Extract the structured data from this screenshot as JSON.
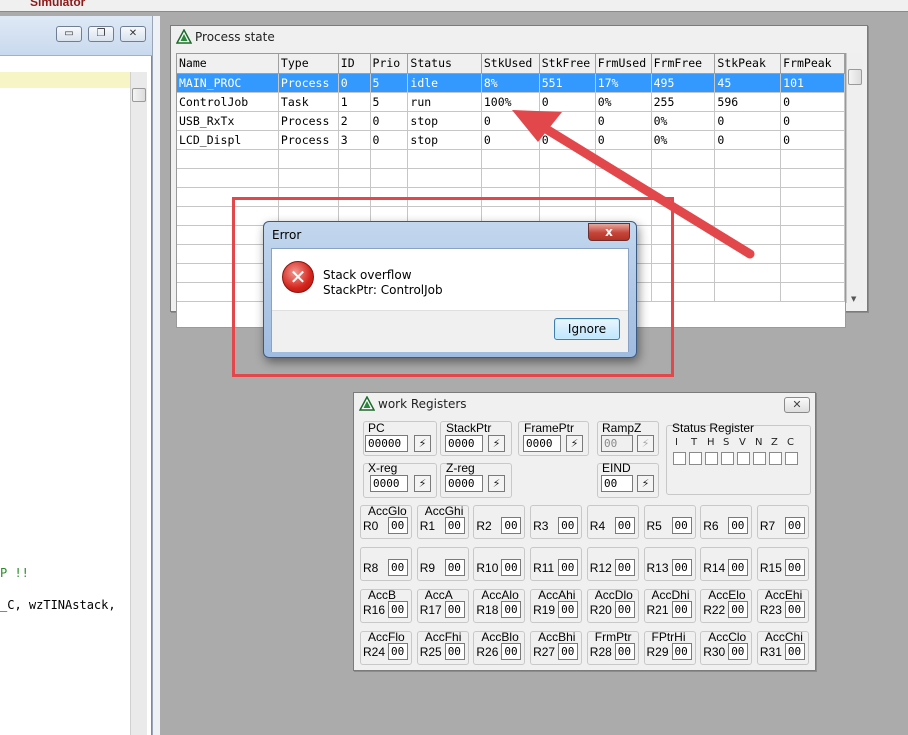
{
  "app": {
    "name": "Simulator"
  },
  "editor": {
    "line_a": "P !!",
    "line_b": "_C, wzTINAstack,"
  },
  "process_window": {
    "title": "Process state",
    "columns": [
      "Name",
      "Type",
      "ID",
      "Prio",
      "Status",
      "StkUsed",
      "StkFree",
      "FrmUsed",
      "FrmFree",
      "StkPeak",
      "FrmPeak"
    ],
    "rows": [
      [
        "MAIN_PROC",
        "Process",
        "0",
        "5",
        "idle",
        "8%",
        "551",
        "17%",
        "495",
        "45",
        "101"
      ],
      [
        "ControlJob",
        "Task",
        "1",
        "5",
        "run",
        "100%",
        "0",
        "0%",
        "255",
        "596",
        "0"
      ],
      [
        "USB_RxTx",
        "Process",
        "2",
        "0",
        "stop",
        "0",
        "0",
        "0",
        "0%",
        "0",
        "0"
      ],
      [
        "LCD_Displ",
        "Process",
        "3",
        "0",
        "stop",
        "0",
        "0",
        "0",
        "0%",
        "0",
        "0"
      ]
    ],
    "selected_row": 0
  },
  "error_dialog": {
    "title": "Error",
    "close_label": "x",
    "message_line1": "Stack overflow",
    "message_line2": "StackPtr: ControlJob",
    "ignore_label": "Ignore"
  },
  "registers_window": {
    "title": "work Registers",
    "pc": {
      "label": "PC",
      "value": "00000"
    },
    "stackptr": {
      "label": "StackPtr",
      "value": "0000"
    },
    "frameptr": {
      "label": "FramePtr",
      "value": "0000"
    },
    "rampz": {
      "label": "RampZ",
      "value": "00"
    },
    "xreg": {
      "label": "X-reg",
      "value": "0000"
    },
    "zreg": {
      "label": "Z-reg",
      "value": "0000"
    },
    "eind": {
      "label": "EIND",
      "value": "00"
    },
    "status_register": {
      "label": "Status Register",
      "flags": [
        "I",
        "T",
        "H",
        "S",
        "V",
        "N",
        "Z",
        "C"
      ]
    },
    "registers": [
      {
        "alias": "AccGlo",
        "name": "R0",
        "value": "00"
      },
      {
        "alias": "AccGhi",
        "name": "R1",
        "value": "00"
      },
      {
        "alias": "",
        "name": "R2",
        "value": "00"
      },
      {
        "alias": "",
        "name": "R3",
        "value": "00"
      },
      {
        "alias": "",
        "name": "R4",
        "value": "00"
      },
      {
        "alias": "",
        "name": "R5",
        "value": "00"
      },
      {
        "alias": "",
        "name": "R6",
        "value": "00"
      },
      {
        "alias": "",
        "name": "R7",
        "value": "00"
      },
      {
        "alias": "",
        "name": "R8",
        "value": "00"
      },
      {
        "alias": "",
        "name": "R9",
        "value": "00"
      },
      {
        "alias": "",
        "name": "R10",
        "value": "00"
      },
      {
        "alias": "",
        "name": "R11",
        "value": "00"
      },
      {
        "alias": "",
        "name": "R12",
        "value": "00"
      },
      {
        "alias": "",
        "name": "R13",
        "value": "00"
      },
      {
        "alias": "",
        "name": "R14",
        "value": "00"
      },
      {
        "alias": "",
        "name": "R15",
        "value": "00"
      },
      {
        "alias": "AccB",
        "name": "R16",
        "value": "00"
      },
      {
        "alias": "AccA",
        "name": "R17",
        "value": "00"
      },
      {
        "alias": "AccAlo",
        "name": "R18",
        "value": "00"
      },
      {
        "alias": "AccAhi",
        "name": "R19",
        "value": "00"
      },
      {
        "alias": "AccDlo",
        "name": "R20",
        "value": "00"
      },
      {
        "alias": "AccDhi",
        "name": "R21",
        "value": "00"
      },
      {
        "alias": "AccElo",
        "name": "R22",
        "value": "00"
      },
      {
        "alias": "AccEhi",
        "name": "R23",
        "value": "00"
      },
      {
        "alias": "AccFlo",
        "name": "R24",
        "value": "00"
      },
      {
        "alias": "AccFhi",
        "name": "R25",
        "value": "00"
      },
      {
        "alias": "AccBlo",
        "name": "R26",
        "value": "00"
      },
      {
        "alias": "AccBhi",
        "name": "R27",
        "value": "00"
      },
      {
        "alias": "FrmPtr",
        "name": "R28",
        "value": "00"
      },
      {
        "alias": "FPtrHi",
        "name": "R29",
        "value": "00"
      },
      {
        "alias": "AccClo",
        "name": "R30",
        "value": "00"
      },
      {
        "alias": "AccChi",
        "name": "R31",
        "value": "00"
      }
    ]
  },
  "icons": {
    "app_icon": "triangle-app-icon",
    "edit_icon": "lightning-edit-icon",
    "error_icon": "error-x-icon"
  },
  "colors": {
    "selection": "#3399ff",
    "annotation": "#e2474b",
    "error_red": "#d3241b"
  }
}
